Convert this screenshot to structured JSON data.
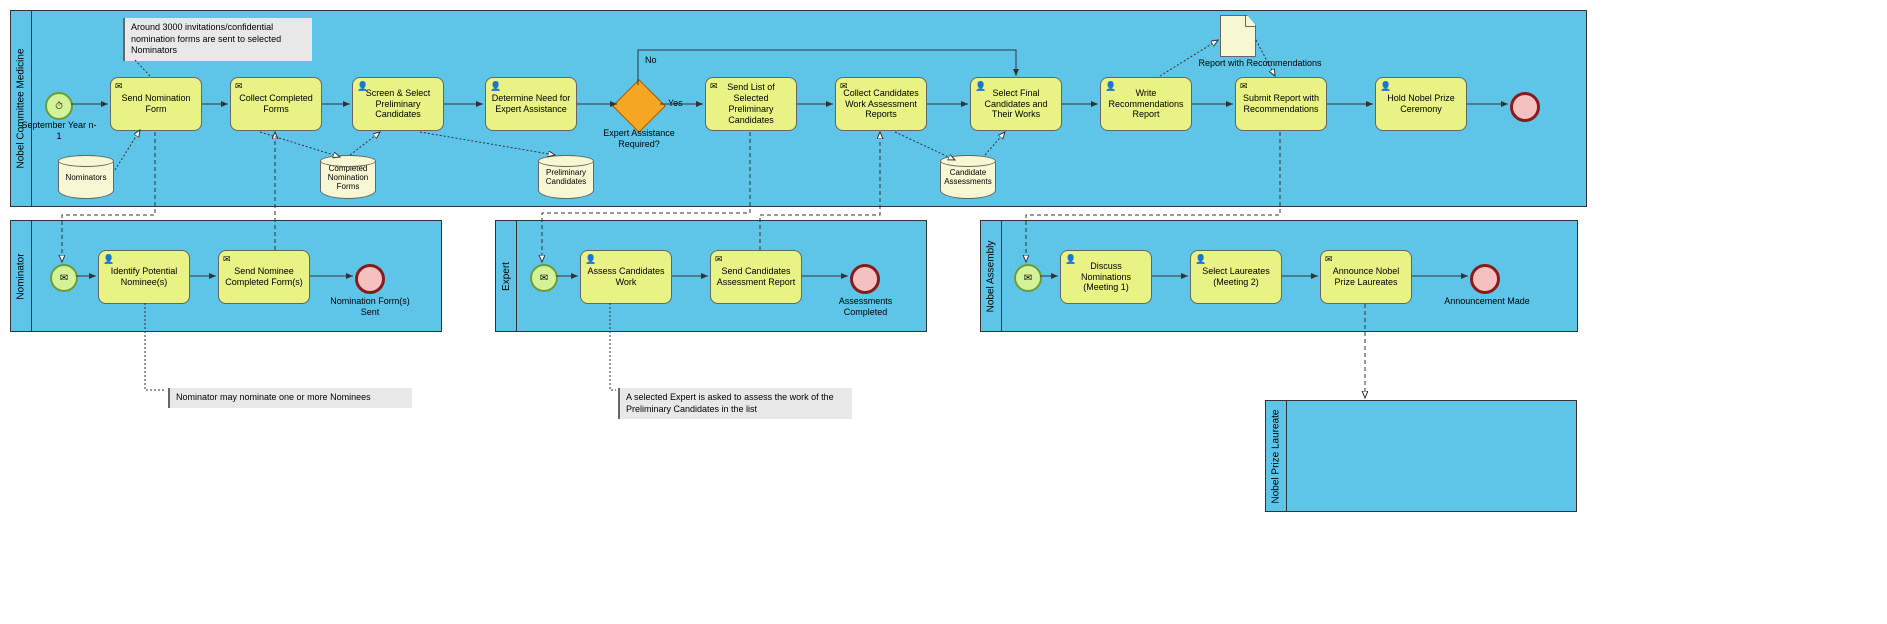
{
  "pools": {
    "p1": "Nobel Committee Medicine",
    "p2": "Nominator",
    "p3": "Expert",
    "p4": "Nobel Assembly",
    "p5": "Nobel Prize Laureate"
  },
  "tasks": {
    "t1": "Send Nomination Form",
    "t2": "Collect Completed Forms",
    "t3": "Screen & Select  Preliminary Candidates",
    "t4": "Determine Need for Expert Assistance",
    "t5": "Send List of Selected Preliminary Candidates",
    "t6": "Collect Candidates Work Assessment Reports",
    "t7": "Select Final Candidates and Their Works",
    "t8": "Write Recommendations Report",
    "t9": "Submit Report with Recommendations",
    "t10": "Hold Nobel Prize Ceremony",
    "t11": "Identify Potential Nominee(s)",
    "t12": "Send Nominee Completed Form(s)",
    "t13": "Assess Candidates Work",
    "t14": "Send Candidates Assessment Report",
    "t15": "Discuss Nominations (Meeting 1)",
    "t16": "Select Laureates (Meeting 2)",
    "t17": "Announce Nobel Prize Laureates"
  },
  "labels": {
    "start1": "September Year n-1",
    "gw": "Expert Assistance Required?",
    "gwYes": "Yes",
    "gwNo": "No",
    "end2": "Nomination Form(s) Sent",
    "end3": "Assessments Completed",
    "end4": "Announcement Made",
    "doc": "Report with Recommendations"
  },
  "datastores": {
    "d1": "Nominators",
    "d2": "Completed Nomination Forms",
    "d3": "Preliminary Candidates",
    "d4": "Candidate Assessments"
  },
  "notes": {
    "n1": "Around 3000 invitations/confidential nomination forms are sent to selected Nominators",
    "n2": "Nominator may nominate one or more Nominees",
    "n3": "A selected Expert is asked to assess the work of the Preliminary Candidates in the list"
  },
  "icons": {
    "timer": "⏱",
    "envelope": "✉",
    "user": "👤"
  },
  "chart_data": {
    "type": "bpmn-process",
    "pools": [
      {
        "name": "Nobel Committee Medicine",
        "tasks": [
          "Send Nomination Form",
          "Collect Completed Forms",
          "Screen & Select Preliminary Candidates",
          "Determine Need for Expert Assistance",
          "Send List of Selected Preliminary Candidates",
          "Collect Candidates Work Assessment Reports",
          "Select Final Candidates and Their Works",
          "Write Recommendations Report",
          "Submit Report with Recommendations",
          "Hold Nobel Prize Ceremony"
        ],
        "start": "September Year n-1 (timer)",
        "end": "terminate"
      },
      {
        "name": "Nominator",
        "tasks": [
          "Identify Potential Nominee(s)",
          "Send Nominee Completed Form(s)"
        ],
        "start": "message",
        "end": "Nomination Form(s) Sent"
      },
      {
        "name": "Expert",
        "tasks": [
          "Assess Candidates Work",
          "Send Candidates Assessment Report"
        ],
        "start": "message",
        "end": "Assessments Completed"
      },
      {
        "name": "Nobel Assembly",
        "tasks": [
          "Discuss Nominations (Meeting 1)",
          "Select Laureates (Meeting 2)",
          "Announce Nobel Prize Laureates"
        ],
        "start": "message",
        "end": "Announcement Made"
      },
      {
        "name": "Nobel Prize Laureate",
        "tasks": []
      }
    ],
    "gateways": [
      {
        "label": "Expert Assistance Required?",
        "outgoing": [
          "Yes→Send List of Selected Preliminary Candidates",
          "No→Select Final Candidates and Their Works"
        ]
      }
    ],
    "datastores": [
      "Nominators",
      "Completed Nomination Forms",
      "Preliminary Candidates",
      "Candidate Assessments"
    ],
    "dataobjects": [
      "Report with Recommendations"
    ],
    "annotations": [
      "Around 3000 invitations/confidential nomination forms are sent to selected Nominators",
      "Nominator may nominate one or more Nominees",
      "A selected Expert is asked to assess the work of the Preliminary Candidates in the list"
    ]
  }
}
